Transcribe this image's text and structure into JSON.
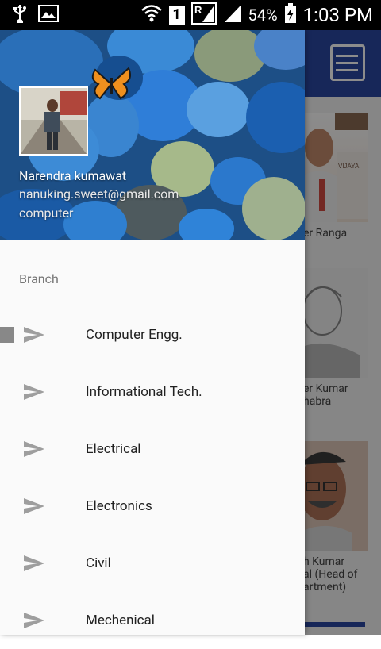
{
  "status_bar": {
    "sim": "1",
    "battery": "54%",
    "time": "1:03 PM",
    "icons": [
      "usb-icon",
      "image-icon",
      "wifi-icon",
      "signal-icon",
      "battery-icon"
    ]
  },
  "drawer": {
    "header": {
      "name": "Narendra kumawat",
      "email": "nanuking.sweet@gmail.com",
      "department": "computer"
    },
    "section_label": "Branch",
    "items": [
      {
        "label": "Computer Engg.",
        "selected": true
      },
      {
        "label": "Informational Tech.",
        "selected": false
      },
      {
        "label": "Electrical",
        "selected": false
      },
      {
        "label": "Electronics",
        "selected": false
      },
      {
        "label": "Civil",
        "selected": false
      },
      {
        "label": "Mechenical",
        "selected": false
      }
    ]
  },
  "background": {
    "faculty": [
      {
        "name_lines": [
          "er Ranga"
        ]
      },
      {
        "name_lines": [
          "er Kumar",
          "habra"
        ]
      },
      {
        "name_lines": [
          "h Kumar",
          "al (Head of",
          "artment)"
        ]
      }
    ]
  },
  "colors": {
    "appbar": "#2b47a3",
    "drawer_bg": "#fafafa",
    "icon_gray": "#9e9e9e"
  }
}
